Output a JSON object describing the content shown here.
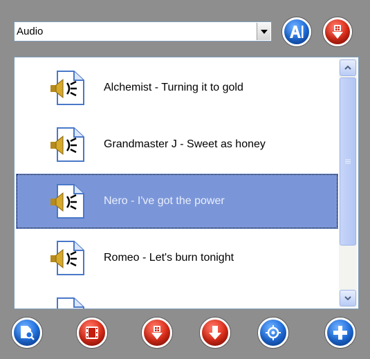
{
  "category_select": {
    "selected": "Audio"
  },
  "top_buttons": [
    {
      "name": "ai-button",
      "icon": "text-cursor-icon",
      "color": "#1f6fe0"
    },
    {
      "name": "download-button",
      "icon": "download-arrow-icon",
      "color": "#e02c18"
    }
  ],
  "tracks": [
    {
      "label": "Alchemist - Turning it to gold",
      "icon": "audio-file-icon",
      "selected": false
    },
    {
      "label": "Grandmaster J - Sweet as honey",
      "icon": "audio-file-icon",
      "selected": false
    },
    {
      "label": "Nero -  I've got the power",
      "icon": "audio-file-icon",
      "selected": true
    },
    {
      "label": "Romeo -  Let's burn tonight",
      "icon": "audio-file-icon",
      "selected": false
    },
    {
      "label": "",
      "icon": "audio-file-icon",
      "selected": false
    }
  ],
  "bottom_buttons": [
    {
      "name": "find-file-button",
      "icon": "file-search-icon",
      "color": "#1f6fe0"
    },
    {
      "name": "video-button",
      "icon": "film-icon",
      "color": "#e02c18"
    },
    {
      "name": "download-menu-button",
      "icon": "download-arrow-icon",
      "color": "#e02c18"
    },
    {
      "name": "save-down-button",
      "icon": "arrow-down-icon",
      "color": "#e02c18"
    },
    {
      "name": "target-button",
      "icon": "crosshair-icon",
      "color": "#1f6fe0"
    },
    {
      "name": "add-button",
      "icon": "plus-icon",
      "color": "#1f6fe0"
    }
  ],
  "colors": {
    "background": "#8e8e8e",
    "selection": "#7b96d8",
    "scrollbar": "#b2c6f5"
  }
}
